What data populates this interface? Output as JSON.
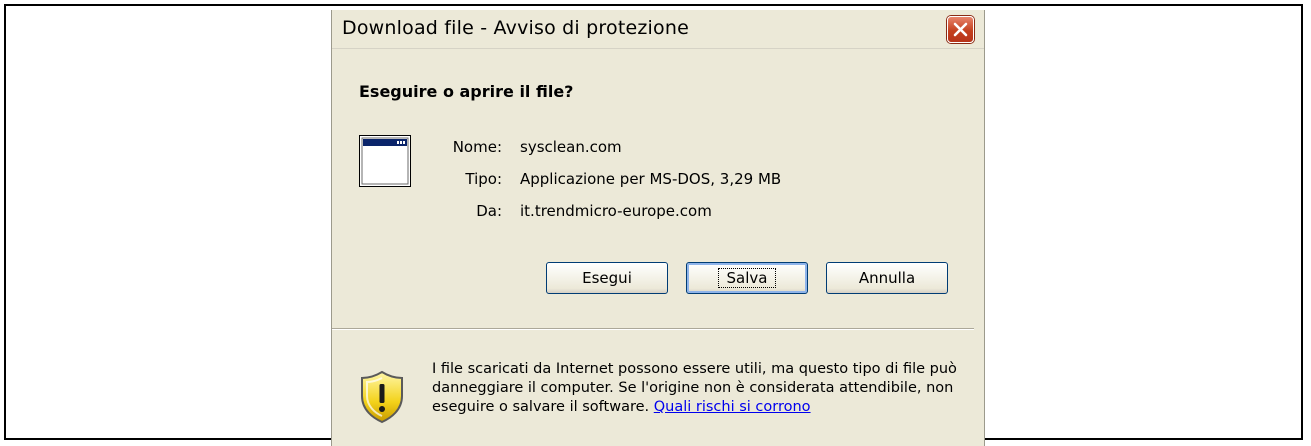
{
  "dialog": {
    "title": "Download file - Avviso di protezione",
    "heading": "Eseguire o aprire il file?",
    "file_info": [
      {
        "label": "Nome:",
        "value": "sysclean.com"
      },
      {
        "label": "Tipo:",
        "value": "Applicazione per MS-DOS, 3,29 MB"
      },
      {
        "label": "Da:",
        "value": "it.trendmicro-europe.com"
      }
    ],
    "buttons": {
      "run_label": "Esegui",
      "save_label": "Salva",
      "cancel_label": "Annulla"
    },
    "warning": {
      "text": "I file scaricati da Internet possono essere utili, ma questo tipo di file può danneggiare il computer. Se l'origine non è considerata attendibile, non eseguire o salvare il software.",
      "link": "Quali rischi si corrono"
    }
  },
  "icons": {
    "close": "close-icon",
    "application": "application-window-icon",
    "security": "shield-warning-icon"
  }
}
